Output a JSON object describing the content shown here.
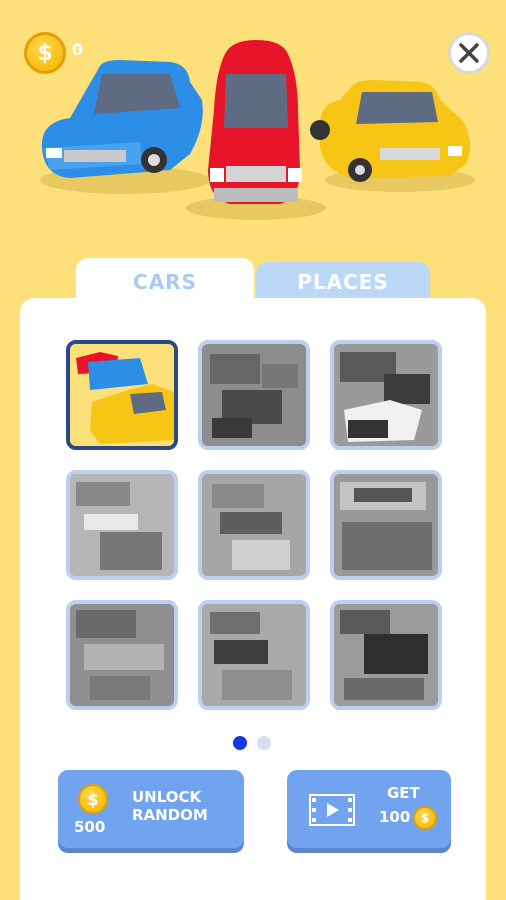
{
  "header": {
    "coin_symbol": "$",
    "coin_count": "0",
    "close_icon": "close-icon"
  },
  "tabs": [
    {
      "label": "CARS",
      "active": true
    },
    {
      "label": "PLACES",
      "active": false
    }
  ],
  "pagination": {
    "pages": 2,
    "current": 1
  },
  "buttons": {
    "unlock": {
      "price": "500",
      "label": "UNLOCK RANDOM",
      "coin_symbol": "$"
    },
    "get": {
      "label": "GET",
      "amount": "100",
      "coin_symbol": "$",
      "icon": "video-icon"
    }
  },
  "colors": {
    "background": "#fde07a",
    "accent": "#72a3ee",
    "selected_border": "#2a4a85",
    "active_dot": "#1636e8"
  }
}
